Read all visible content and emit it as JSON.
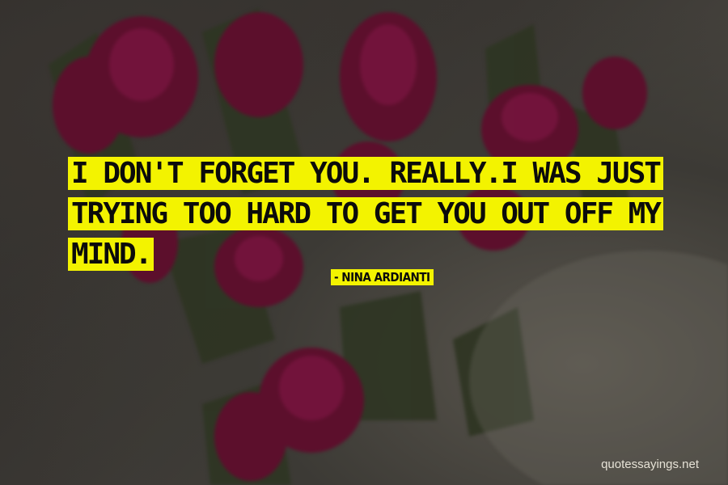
{
  "quote": {
    "text": "I don't forget you. Really.I was just trying too hard to get you out off my mind."
  },
  "author": {
    "text": "- Nina Ardianti"
  },
  "watermark": {
    "text": "quotessayings.net"
  },
  "colors": {
    "highlight": "#f3f300",
    "text": "#0b0b0b",
    "background": "#3a3733",
    "tulip": "#6b1030",
    "watermark": "#e6e2d6"
  }
}
